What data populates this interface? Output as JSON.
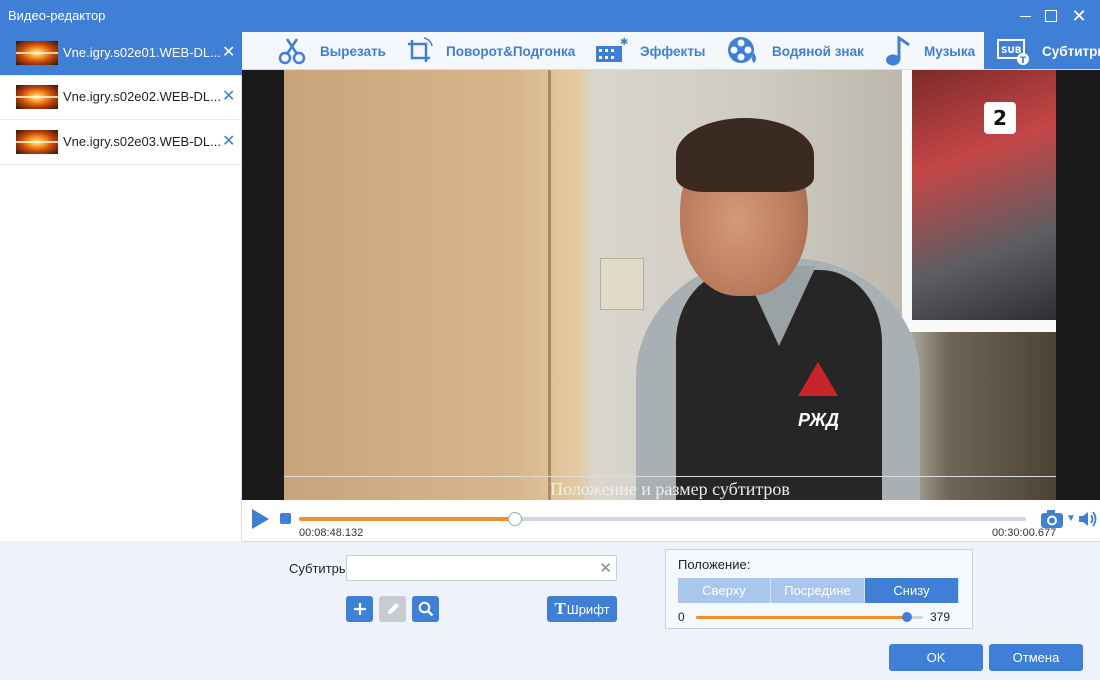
{
  "window": {
    "title": "Видео-редактор"
  },
  "files": [
    {
      "name": "Vne.igry.s02e01.WEB-DL..."
    },
    {
      "name": "Vne.igry.s02e02.WEB-DL..."
    },
    {
      "name": "Vne.igry.s02e03.WEB-DL..."
    }
  ],
  "tabs": [
    {
      "label": "Вырезать",
      "icon": "scissors-icon"
    },
    {
      "label": "Поворот&Подгонка",
      "icon": "rotate-crop-icon"
    },
    {
      "label": "Эффекты",
      "icon": "effects-icon"
    },
    {
      "label": "Водяной знак",
      "icon": "watermark-icon"
    },
    {
      "label": "Музыка",
      "icon": "music-note-icon"
    },
    {
      "label": "Субтитры",
      "icon": "subtitles-icon"
    }
  ],
  "active_tab": "Субтитры",
  "preview": {
    "subtitle_overlay": "Положение и размер субтитров",
    "logo_badge": "2",
    "vest_text": "РЖД"
  },
  "player": {
    "current_time": "00:08:48.132",
    "total_time": "00:30:00.677",
    "progress": 0.297
  },
  "subtitles_panel": {
    "label": "Субтитры",
    "input_value": "",
    "font_button": "Шрифт",
    "font_button_glyph": "T"
  },
  "position": {
    "label": "Положение:",
    "options": [
      "Сверху",
      "Посредине",
      "Снизу"
    ],
    "selected": "Снизу",
    "min": "0",
    "value": "379",
    "fraction": 0.93
  },
  "dialog": {
    "ok_label": "OK",
    "cancel_label": "Отмена"
  },
  "colors": {
    "accent": "#3f7fd6",
    "progress": "#ef8f2e",
    "segment_inactive": "#a9c6ec"
  }
}
